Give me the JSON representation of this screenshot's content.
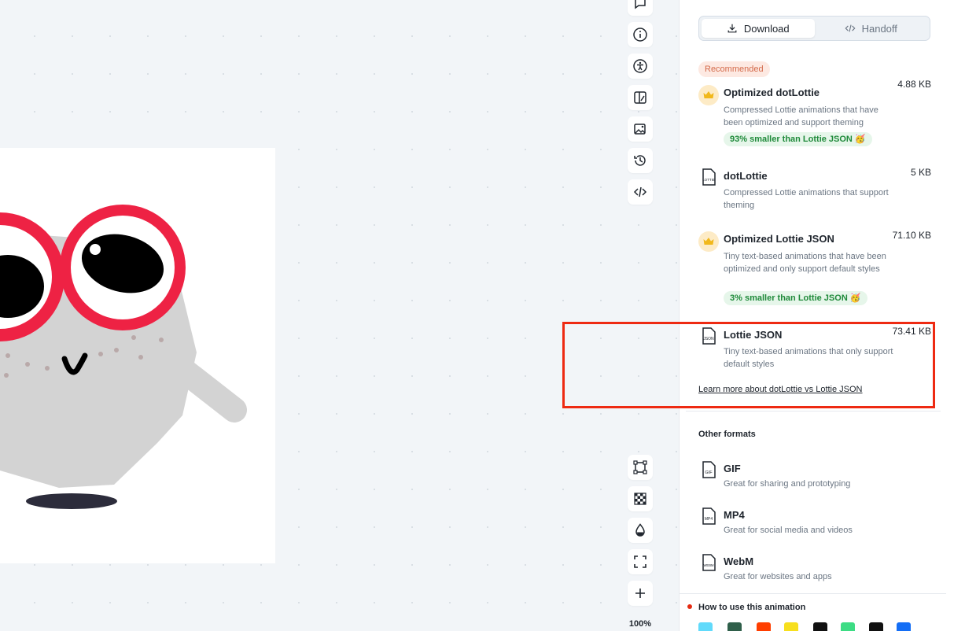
{
  "tabs": {
    "download": "Download",
    "handoff": "Handoff"
  },
  "recommended_label": "Recommended",
  "formats": [
    {
      "title": "Optimized dotLottie",
      "size": "4.88 KB",
      "desc": "Compressed Lottie animations that have been optimized and support theming",
      "badge": "93% smaller than Lottie JSON 🥳",
      "icon": "crown-icon"
    },
    {
      "title": "dotLottie",
      "size": "5 KB",
      "desc": "Compressed Lottie animations that support theming",
      "icon": "lottie-file-icon"
    },
    {
      "title": "Optimized Lottie JSON",
      "size": "71.10 KB",
      "desc": "Tiny text-based animations that have been optimized and only support default styles",
      "badge": "3% smaller than Lottie JSON 🥳",
      "icon": "crown-icon"
    },
    {
      "title": "Lottie JSON",
      "size": "73.41 KB",
      "desc": "Tiny text-based animations that only support default styles",
      "icon": "json-file-icon"
    }
  ],
  "learn_more": "Learn more about dotLottie vs Lottie JSON",
  "other_formats_title": "Other formats",
  "other_formats": [
    {
      "title": "GIF",
      "desc": "Great for sharing and prototyping",
      "icon_text": "GIF"
    },
    {
      "title": "MP4",
      "desc": "Great for social media and videos",
      "icon_text": "MP4"
    },
    {
      "title": "WebM",
      "desc": "Great for websites and apps",
      "icon_text": "WEBM"
    }
  ],
  "how_to": "How to use this animation",
  "zoom": "100%",
  "colors": {
    "accent_red": "#ee2a12",
    "badge_green_bg": "#e6f6ea",
    "badge_green_text": "#1f8a3a",
    "recommended_bg": "#fde9e2",
    "recommended_text": "#d46a4a"
  }
}
